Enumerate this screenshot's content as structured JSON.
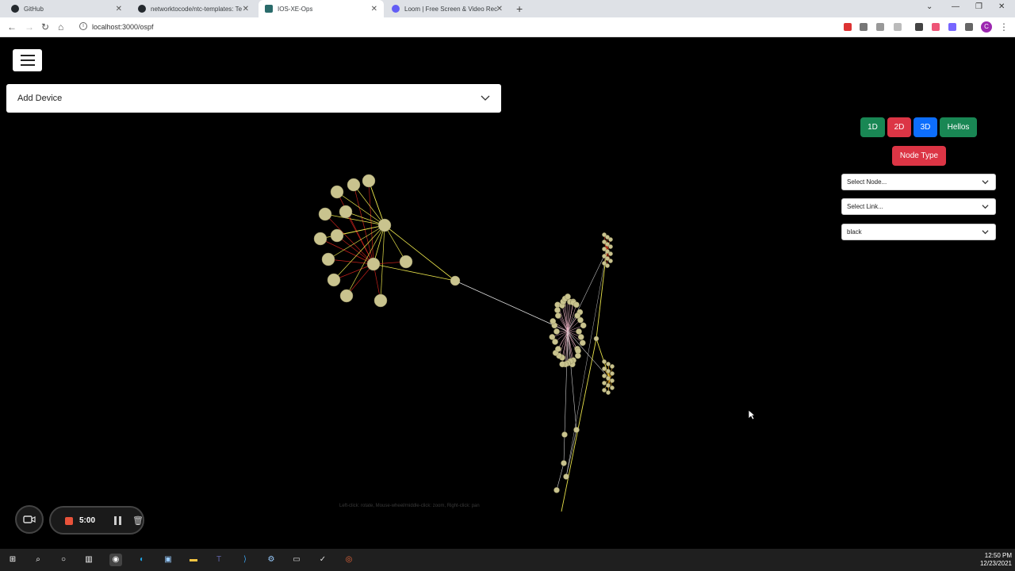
{
  "browser": {
    "tabs": [
      {
        "label": "GitHub",
        "color": "#24292e",
        "active": false
      },
      {
        "label": "networktocode/ntc-templates: Te",
        "color": "#24292e",
        "active": false
      },
      {
        "label": "IOS-XE-Ops",
        "color": "#2a6b6b",
        "active": true
      },
      {
        "label": "Loom | Free Screen & Video Rec",
        "color": "#625df5",
        "active": false
      }
    ],
    "url": "localhost:3000/ospf",
    "profile_initial": "C"
  },
  "app": {
    "accordion_label": "Add Device",
    "view_buttons": [
      {
        "label": "1D",
        "color": "#198754"
      },
      {
        "label": "2D",
        "color": "#dc3545"
      },
      {
        "label": "3D",
        "color": "#0d6efd"
      },
      {
        "label": "Hellos",
        "color": "#198754"
      }
    ],
    "node_type_label": "Node Type",
    "selects": {
      "node": "Select Node...",
      "link": "Select Link...",
      "background": "black"
    },
    "hint": "Left-click: rotate, Mouse-wheel/middle-click: zoom, Right-click: pan"
  },
  "recorder": {
    "time": "5:00"
  },
  "taskbar": {
    "time": "12:50 PM",
    "date": "12/23/2021"
  }
}
